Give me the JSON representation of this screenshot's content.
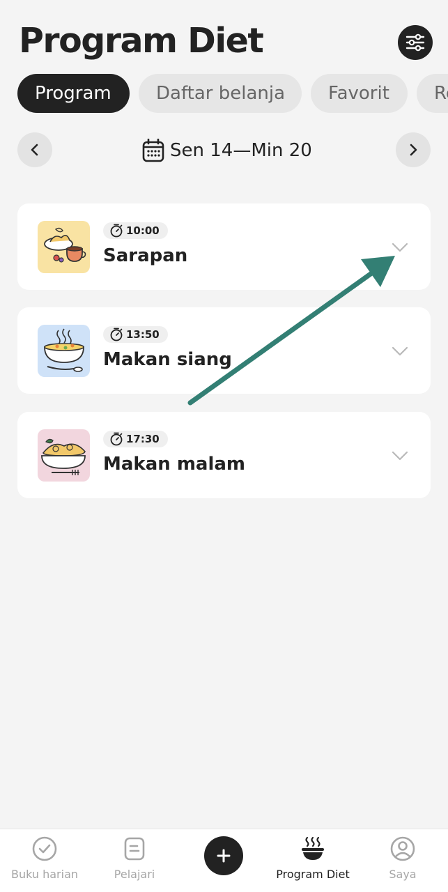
{
  "header": {
    "title": "Program Diet",
    "filter_icon": "sliders-icon"
  },
  "tabs": [
    {
      "label": "Program",
      "active": true
    },
    {
      "label": "Daftar belanja",
      "active": false
    },
    {
      "label": "Favorit",
      "active": false
    },
    {
      "label": "Re",
      "active": false
    }
  ],
  "week": {
    "range": "Sen 14—Min 20",
    "prev_icon": "chevron-left-icon",
    "next_icon": "chevron-right-icon",
    "calendar_icon": "calendar-icon"
  },
  "meals": [
    {
      "time": "10:00",
      "name": "Sarapan",
      "thumb_color": "#f9e3a3",
      "icon": "breakfast-icon"
    },
    {
      "time": "13:50",
      "name": "Makan siang",
      "thumb_color": "#cfe2f8",
      "icon": "soup-bowl-icon"
    },
    {
      "time": "17:30",
      "name": "Makan malam",
      "thumb_color": "#f2d6de",
      "icon": "pasta-bowl-icon"
    }
  ],
  "annotation": {
    "arrow_color": "#337f74"
  },
  "bottom_nav": {
    "items": [
      {
        "label": "Buku harian",
        "icon": "check-circle-icon",
        "active": false
      },
      {
        "label": "Pelajari",
        "icon": "document-icon",
        "active": false
      },
      {
        "label": "",
        "icon": "plus-icon",
        "active": false
      },
      {
        "label": "Program Diet",
        "icon": "steaming-bowl-icon",
        "active": true
      },
      {
        "label": "Saya",
        "icon": "user-circle-icon",
        "active": false
      }
    ]
  },
  "colors": {
    "background": "#f4f4f4",
    "card": "#ffffff",
    "dark": "#222222",
    "muted": "#a6a6a6"
  }
}
